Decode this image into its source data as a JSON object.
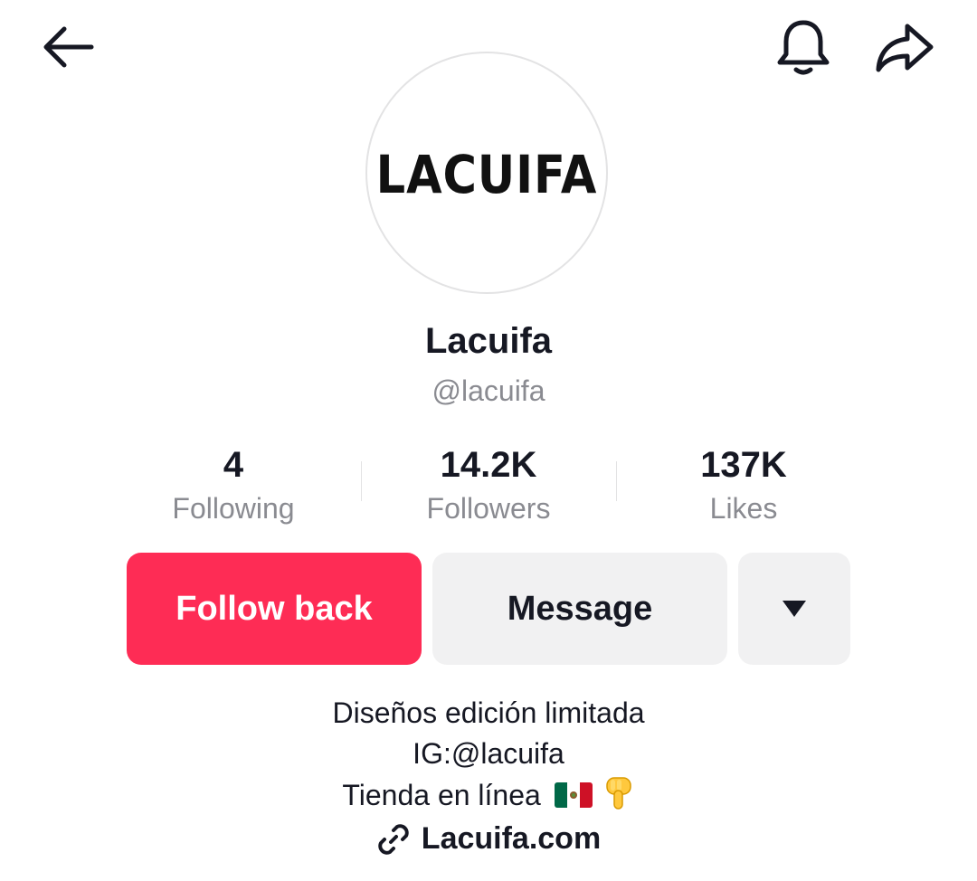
{
  "header": {
    "back_icon": "arrow-left-icon",
    "notification_icon": "bell-icon",
    "share_icon": "share-arrow-icon"
  },
  "profile": {
    "avatar_logo_text": "LACUIFA",
    "display_name": "Lacuifa",
    "username": "@lacuifa"
  },
  "stats": {
    "following": {
      "value": "4",
      "label": "Following"
    },
    "followers": {
      "value": "14.2K",
      "label": "Followers"
    },
    "likes": {
      "value": "137K",
      "label": "Likes"
    }
  },
  "actions": {
    "follow_label": "Follow back",
    "message_label": "Message",
    "more_icon": "caret-down-icon"
  },
  "bio": {
    "line1": "Diseños edición limitada",
    "line2": "IG:@lacuifa",
    "line3": "Tienda en línea",
    "line3_emojis": [
      "mexico-flag-icon",
      "pointing-down-hand-icon"
    ]
  },
  "website": {
    "icon": "link-icon",
    "label": "Lacuifa.com"
  },
  "colors": {
    "primary": "#fe2c55",
    "secondary_button": "#f1f1f2",
    "text": "#161823",
    "muted_text": "#8a8b91"
  }
}
